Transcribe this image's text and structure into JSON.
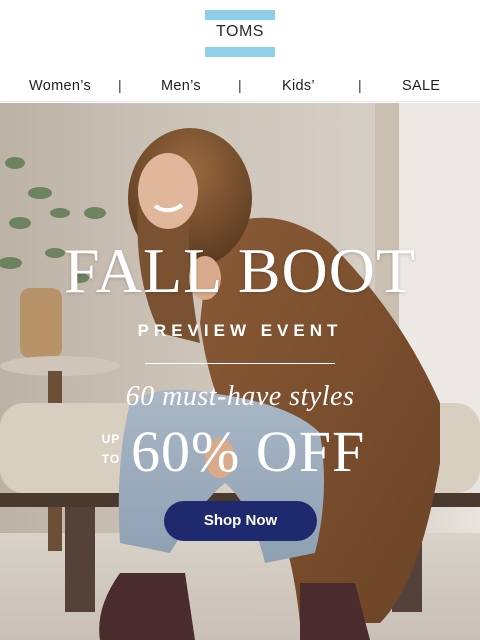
{
  "brand": {
    "logo_text": "TOMS",
    "accent_color": "#8ed0ea"
  },
  "nav": {
    "items": [
      {
        "label": "Women’s"
      },
      {
        "label": "Men’s"
      },
      {
        "label": "Kids’"
      },
      {
        "label": "SALE"
      }
    ],
    "separator": "|"
  },
  "hero": {
    "headline": "FALL BOOT",
    "subhead": "PREVIEW EVENT",
    "tagline": "60 must-have styles",
    "offer_prefix_line1": "UP",
    "offer_prefix_line2": "TO",
    "offer_value": "60% OFF",
    "cta_label": "Shop Now",
    "cta_color": "#1f2a6e"
  }
}
